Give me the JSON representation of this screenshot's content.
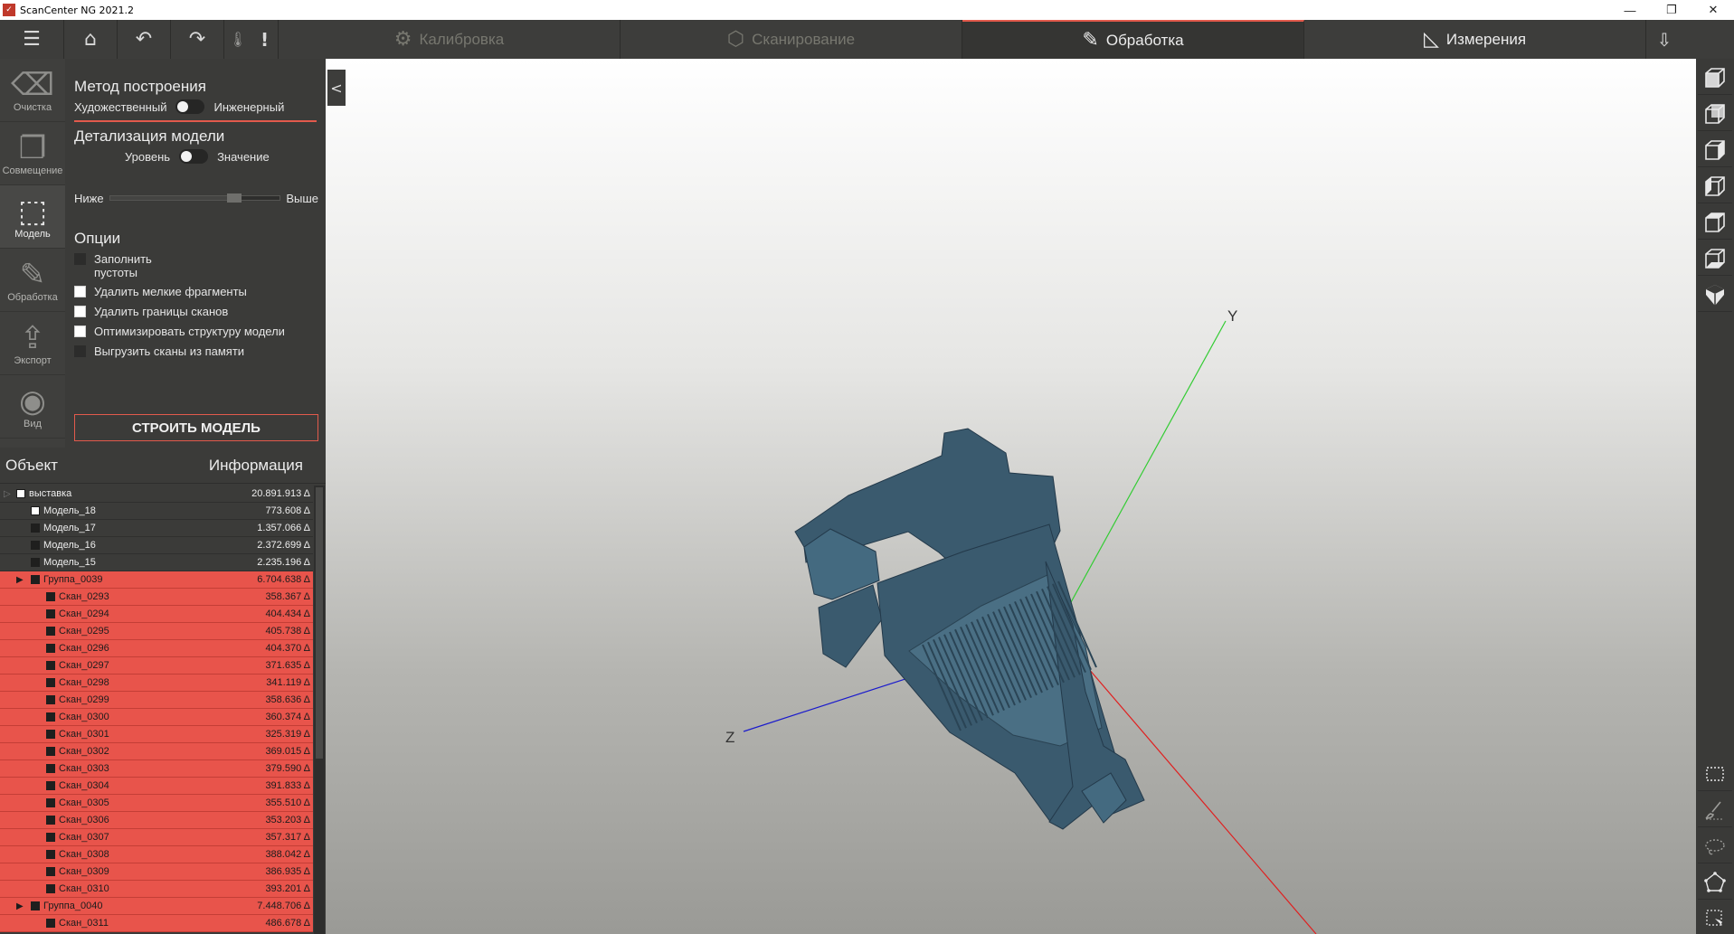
{
  "window": {
    "title": "ScanCenter NG 2021.2",
    "logo_text": "✓",
    "controls": [
      "minimize",
      "restore",
      "close"
    ]
  },
  "toolbar": {
    "icons": [
      {
        "name": "menu-icon",
        "glyph": "☰"
      },
      {
        "name": "home-icon",
        "glyph": "⌂"
      },
      {
        "name": "undo-icon",
        "glyph": "↶"
      },
      {
        "name": "redo-icon",
        "glyph": "↷"
      },
      {
        "name": "temperature-icon",
        "glyph": "🌡"
      },
      {
        "name": "alert-icon",
        "glyph": "!"
      }
    ],
    "tabs": [
      {
        "label": "Калибровка",
        "icon": "gear-icon",
        "glyph": "⚙",
        "state": "disabled"
      },
      {
        "label": "Сканирование",
        "icon": "cube-icon",
        "glyph": "⬡",
        "state": "disabled"
      },
      {
        "label": "Обработка",
        "icon": "pencil-icon",
        "glyph": "✎",
        "state": "active"
      },
      {
        "label": "Измерения",
        "icon": "triangle-ruler-icon",
        "glyph": "◺",
        "state": "normal"
      }
    ],
    "download_glyph": "⇩"
  },
  "leftnav": [
    {
      "label": "Очистка",
      "icon": "eraser-icon",
      "glyph": "⌫"
    },
    {
      "label": "Совмещение",
      "icon": "align-icon",
      "glyph": "❐"
    },
    {
      "label": "Модель",
      "icon": "model-cube-icon",
      "glyph": "⬚",
      "active": true
    },
    {
      "label": "Обработка",
      "icon": "pencil-icon",
      "glyph": "✎"
    },
    {
      "label": "Экспорт",
      "icon": "export-icon",
      "glyph": "⇪"
    },
    {
      "label": "Вид",
      "icon": "view-eye-icon",
      "glyph": "◉"
    }
  ],
  "settings": {
    "build_method": {
      "title": "Метод построения",
      "left": "Художественный",
      "right": "Инженерный"
    },
    "detail": {
      "title": "Детализация модели",
      "left": "Уровень",
      "right": "Значение",
      "low": "Ниже",
      "high": "Выше",
      "slider_value": 0.73
    },
    "options": {
      "title": "Опции",
      "items": [
        {
          "label": "Заполнить\nпустоты",
          "checked_style": "dark"
        },
        {
          "label": "Удалить мелкие фрагменты",
          "checked_style": "white"
        },
        {
          "label": "Удалить границы сканов",
          "checked_style": "white"
        },
        {
          "label": "Оптимизировать структуру модели",
          "checked_style": "white"
        },
        {
          "label": "Выгрузить сканы из памяти",
          "checked_style": "dark"
        }
      ]
    },
    "build_button": "СТРОИТЬ МОДЕЛЬ"
  },
  "objects": {
    "col_object": "Объект",
    "col_info": "Информация",
    "rows": [
      {
        "name": "выставка",
        "value": "20.891.913 Δ",
        "level": 0,
        "arrow": "▷",
        "box": "white",
        "hl": false
      },
      {
        "name": "Модель_18",
        "value": "773.608 Δ",
        "level": 1,
        "arrow": "",
        "box": "white",
        "hl": false
      },
      {
        "name": "Модель_17",
        "value": "1.357.066 Δ",
        "level": 1,
        "arrow": "",
        "box": "dark",
        "hl": false
      },
      {
        "name": "Модель_16",
        "value": "2.372.699 Δ",
        "level": 1,
        "arrow": "",
        "box": "dark",
        "hl": false
      },
      {
        "name": "Модель_15",
        "value": "2.235.196 Δ",
        "level": 1,
        "arrow": "",
        "box": "dark",
        "hl": false
      },
      {
        "name": "Группа_0039",
        "value": "6.704.638 Δ",
        "level": 1,
        "arrow": "▶",
        "box": "dark",
        "hl": true
      },
      {
        "name": "Скан_0293",
        "value": "358.367 Δ",
        "level": 2,
        "arrow": "",
        "box": "dark",
        "hl": true
      },
      {
        "name": "Скан_0294",
        "value": "404.434 Δ",
        "level": 2,
        "arrow": "",
        "box": "dark",
        "hl": true
      },
      {
        "name": "Скан_0295",
        "value": "405.738 Δ",
        "level": 2,
        "arrow": "",
        "box": "dark",
        "hl": true
      },
      {
        "name": "Скан_0296",
        "value": "404.370 Δ",
        "level": 2,
        "arrow": "",
        "box": "dark",
        "hl": true
      },
      {
        "name": "Скан_0297",
        "value": "371.635 Δ",
        "level": 2,
        "arrow": "",
        "box": "dark",
        "hl": true
      },
      {
        "name": "Скан_0298",
        "value": "341.119 Δ",
        "level": 2,
        "arrow": "",
        "box": "dark",
        "hl": true
      },
      {
        "name": "Скан_0299",
        "value": "358.636 Δ",
        "level": 2,
        "arrow": "",
        "box": "dark",
        "hl": true
      },
      {
        "name": "Скан_0300",
        "value": "360.374 Δ",
        "level": 2,
        "arrow": "",
        "box": "dark",
        "hl": true
      },
      {
        "name": "Скан_0301",
        "value": "325.319 Δ",
        "level": 2,
        "arrow": "",
        "box": "dark",
        "hl": true
      },
      {
        "name": "Скан_0302",
        "value": "369.015 Δ",
        "level": 2,
        "arrow": "",
        "box": "dark",
        "hl": true
      },
      {
        "name": "Скан_0303",
        "value": "379.590 Δ",
        "level": 2,
        "arrow": "",
        "box": "dark",
        "hl": true
      },
      {
        "name": "Скан_0304",
        "value": "391.833 Δ",
        "level": 2,
        "arrow": "",
        "box": "dark",
        "hl": true
      },
      {
        "name": "Скан_0305",
        "value": "355.510 Δ",
        "level": 2,
        "arrow": "",
        "box": "dark",
        "hl": true
      },
      {
        "name": "Скан_0306",
        "value": "353.203 Δ",
        "level": 2,
        "arrow": "",
        "box": "dark",
        "hl": true
      },
      {
        "name": "Скан_0307",
        "value": "357.317 Δ",
        "level": 2,
        "arrow": "",
        "box": "dark",
        "hl": true
      },
      {
        "name": "Скан_0308",
        "value": "388.042 Δ",
        "level": 2,
        "arrow": "",
        "box": "dark",
        "hl": true
      },
      {
        "name": "Скан_0309",
        "value": "386.935 Δ",
        "level": 2,
        "arrow": "",
        "box": "dark",
        "hl": true
      },
      {
        "name": "Скан_0310",
        "value": "393.201 Δ",
        "level": 2,
        "arrow": "",
        "box": "dark",
        "hl": true
      },
      {
        "name": "Группа_0040",
        "value": "7.448.706 Δ",
        "level": 1,
        "arrow": "▶",
        "box": "dark",
        "hl": true
      },
      {
        "name": "Скан_0311",
        "value": "486.678 Δ",
        "level": 2,
        "arrow": "",
        "box": "dark",
        "hl": true
      }
    ]
  },
  "viewport": {
    "axis_labels": {
      "x": "",
      "y": "Y",
      "z": "Z"
    },
    "axis_colors": {
      "x": "#e02020",
      "y": "#33cc33",
      "z": "#1a1acc"
    },
    "model_color": "#3a5a6e",
    "collapse_glyph": "<"
  },
  "right_views": [
    {
      "name": "view-front-icon"
    },
    {
      "name": "view-back-icon"
    },
    {
      "name": "view-left-icon"
    },
    {
      "name": "view-right-icon"
    },
    {
      "name": "view-top-icon"
    },
    {
      "name": "view-bottom-icon"
    },
    {
      "name": "view-iso-icon"
    }
  ],
  "right_tools": [
    {
      "name": "rect-select-icon"
    },
    {
      "name": "brush-select-icon"
    },
    {
      "name": "lasso-select-icon"
    },
    {
      "name": "polygon-select-icon"
    },
    {
      "name": "point-select-icon"
    }
  ],
  "colors": {
    "accent": "#e25a4c",
    "highlight_row": "#e8544b",
    "panel": "#3b3b39"
  }
}
